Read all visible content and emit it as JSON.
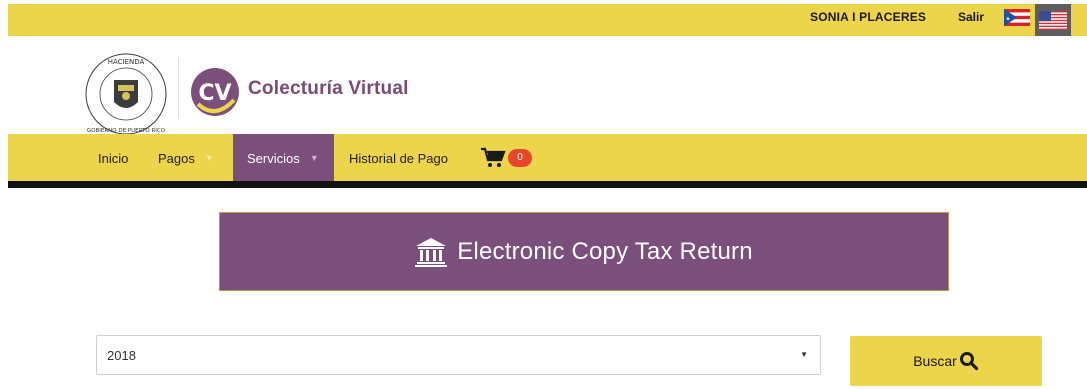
{
  "topbar": {
    "user_name": "SONIA I PLACERES",
    "logout_label": "Salir",
    "languages": [
      {
        "name": "flag-puerto-rico-icon"
      },
      {
        "name": "flag-usa-icon"
      }
    ]
  },
  "brand": {
    "seal_icon": "hacienda-seal",
    "logo_icon": "cv-logo",
    "app_name": "Colecturía Virtual"
  },
  "nav": {
    "items": [
      {
        "label": "Inicio",
        "has_dropdown": false
      },
      {
        "label": "Pagos",
        "has_dropdown": true
      },
      {
        "label": "Servicios",
        "has_dropdown": true,
        "active": true
      },
      {
        "label": "Historial de Pago",
        "has_dropdown": false
      }
    ],
    "cart": {
      "icon": "cart-icon",
      "count": "0"
    }
  },
  "banner": {
    "icon": "bank-icon",
    "title": "Electronic Copy Tax Return"
  },
  "form": {
    "year_select": {
      "value": "2018"
    },
    "search_button": {
      "label": "Buscar",
      "icon": "search-icon"
    }
  },
  "colors": {
    "accent_yellow": "#ecd54a",
    "brand_purple": "#7b4f7c",
    "badge_red": "#e8452d"
  }
}
